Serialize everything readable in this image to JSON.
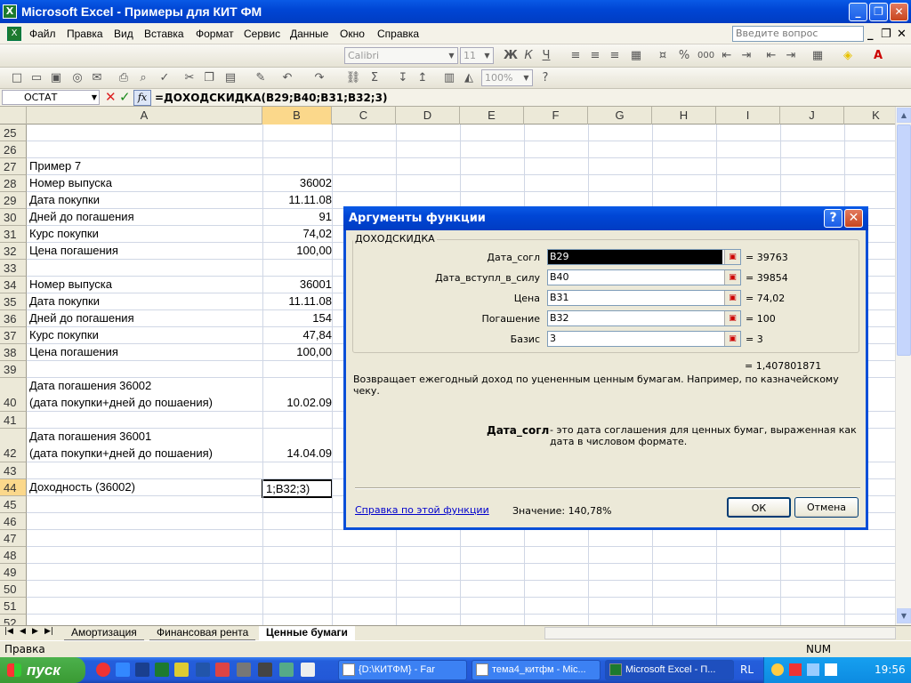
{
  "window": {
    "title": "Microsoft Excel - Примеры для КИТ ФМ",
    "app_icon": "excel-icon"
  },
  "menu": [
    "Файл",
    "Правка",
    "Вид",
    "Вставка",
    "Формат",
    "Сервис",
    "Данные",
    "Окно",
    "Справка"
  ],
  "ask_placeholder": "Введите вопрос",
  "toolbar": {
    "font": "Calibri",
    "size": "11",
    "zoom": "100%",
    "bold": "Ж",
    "italic": "К",
    "underline": "Ч"
  },
  "formula_bar": {
    "name_box": "ОСТАТ",
    "fx": "fx",
    "formula": "=ДОХОДСКИДКА(B29;B40;B31;B32;3)"
  },
  "columns": [
    "A",
    "B",
    "C",
    "D",
    "E",
    "F",
    "G",
    "H",
    "I",
    "J",
    "K"
  ],
  "rows": [
    {
      "num": "25",
      "a": "",
      "b": ""
    },
    {
      "num": "26",
      "a": "",
      "b": ""
    },
    {
      "num": "27",
      "a": "Пример 7",
      "b": ""
    },
    {
      "num": "28",
      "a": "Номер выпуска",
      "b": "36002"
    },
    {
      "num": "29",
      "a": "Дата покупки",
      "b": "11.11.08"
    },
    {
      "num": "30",
      "a": "Дней до погашения",
      "b": "91"
    },
    {
      "num": "31",
      "a": "Курс покупки",
      "b": "74,02"
    },
    {
      "num": "32",
      "a": "Цена погашения",
      "b": "100,00"
    },
    {
      "num": "33",
      "a": "",
      "b": ""
    },
    {
      "num": "34",
      "a": "Номер выпуска",
      "b": "36001"
    },
    {
      "num": "35",
      "a": "Дата покупки",
      "b": "11.11.08"
    },
    {
      "num": "36",
      "a": "Дней до погашения",
      "b": "154"
    },
    {
      "num": "37",
      "a": "Курс покупки",
      "b": "47,84"
    },
    {
      "num": "38",
      "a": "Цена погашения",
      "b": "100,00"
    },
    {
      "num": "39",
      "a": "",
      "b": ""
    },
    {
      "num": "40",
      "a": "Дата погашения 36002",
      "a2": "(дата покупки+дней до пошаения)",
      "b": "10.02.09"
    },
    {
      "num": "41",
      "a": "",
      "b": ""
    },
    {
      "num": "42",
      "a": "Дата погашения 36001",
      "a2": "(дата покупки+дней до пошаения)",
      "b": "14.04.09"
    },
    {
      "num": "43",
      "a": "",
      "b": ""
    },
    {
      "num": "44",
      "a": "Доходность (36002)",
      "b": "1;B32;3)"
    },
    {
      "num": "45",
      "a": "",
      "b": ""
    },
    {
      "num": "46",
      "a": "",
      "b": ""
    },
    {
      "num": "47",
      "a": "",
      "b": ""
    },
    {
      "num": "48",
      "a": "",
      "b": ""
    },
    {
      "num": "49",
      "a": "",
      "b": ""
    },
    {
      "num": "50",
      "a": "",
      "b": ""
    },
    {
      "num": "51",
      "a": "",
      "b": ""
    },
    {
      "num": "52",
      "a": "",
      "b": ""
    }
  ],
  "sheet_tabs": [
    "Амортизация",
    "Финансовая рента",
    "Ценные бумаги"
  ],
  "status": {
    "left": "Правка",
    "num": "NUM"
  },
  "dialog": {
    "title": "Аргументы функции",
    "function": "ДОХОДСКИДКА",
    "args": [
      {
        "label": "Дата_согл",
        "value": "B29",
        "result": "= 39763"
      },
      {
        "label": "Дата_вступл_в_силу",
        "value": "B40",
        "result": "= 39854"
      },
      {
        "label": "Цена",
        "value": "B31",
        "result": "= 74,02"
      },
      {
        "label": "Погашение",
        "value": "B32",
        "result": "= 100"
      },
      {
        "label": "Базис",
        "value": "3",
        "result": "= 3"
      }
    ],
    "result": "= 1,407801871",
    "description": "Возвращает ежегодный доход по уцененным ценным бумагам. Например, по казначейскому чеку.",
    "arg_name": "Дата_согл",
    "arg_description": "- это дата соглашения для ценных бумаг, выраженная как дата в числовом формате.",
    "help_link": "Справка по этой функции",
    "value_label": "Значение: 140,78%",
    "ok": "ОК",
    "cancel": "Отмена"
  },
  "taskbar": {
    "start": "пуск",
    "tasks": [
      "{D:\\КИТФМ} - Far",
      "тема4_китфм - Mic...",
      "Microsoft Excel - П..."
    ],
    "lang": "RL",
    "clock": "19:56"
  }
}
